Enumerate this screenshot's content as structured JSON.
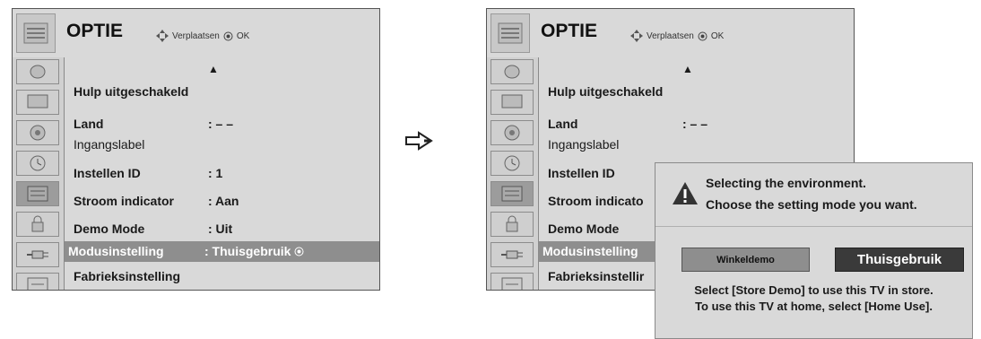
{
  "menu": {
    "title": "OPTIE",
    "hint_move": "Verplaatsen",
    "hint_ok": "OK",
    "items": [
      {
        "label": "Hulp uitgeschakeld",
        "value": ""
      },
      {
        "label": "Land",
        "value": ": – –"
      },
      {
        "label": "Ingangslabel",
        "value": ""
      },
      {
        "label": "Instellen ID",
        "value": ": 1"
      },
      {
        "label": "Stroom indicator",
        "value": ": Aan"
      },
      {
        "label": "Demo Mode",
        "value": ": Uit"
      },
      {
        "label": "Modusinstelling",
        "value": ": Thuisgebruik"
      },
      {
        "label": "Fabrieksinstelling",
        "value": ""
      }
    ],
    "right_truncated": {
      "stroom": "Stroom indicato",
      "modus": "Modusinstelling",
      "fabriek": "Fabrieksinstellir",
      "instellen_value": ": 1"
    },
    "side_icons": [
      "satellite-icon",
      "screen-icon",
      "speaker-icon",
      "clock-icon",
      "option-icon",
      "lock-icon",
      "plug-icon",
      "input-icon"
    ]
  },
  "dialog": {
    "line1": "Selecting the environment.",
    "line2": "Choose the setting mode you want.",
    "option_store": "Winkeldemo",
    "option_home": "Thuisgebruik",
    "help1": "Select [Store Demo] to use this TV in store.",
    "help2": "To use this TV at home, select [Home Use]."
  }
}
